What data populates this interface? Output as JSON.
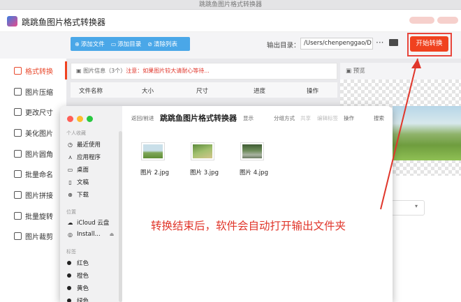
{
  "window": {
    "title": "跳跳鱼图片格式转换器"
  },
  "app": {
    "title": "跳跳鱼图片格式转换器"
  },
  "toolbar": {
    "add_file": "添加文件",
    "add_folder": "添加目录",
    "clear_list": "清除列表",
    "output_label": "输出目录：",
    "output_path": "/Users/chenpenggao/D",
    "more": "···",
    "start": "开始转换"
  },
  "sidebar": {
    "items": [
      {
        "label": "格式转换",
        "active": true
      },
      {
        "label": "图片压缩"
      },
      {
        "label": "更改尺寸"
      },
      {
        "label": "美化图片"
      },
      {
        "label": "图片圆角"
      },
      {
        "label": "批量命名"
      },
      {
        "label": "图片拼接"
      },
      {
        "label": "批量旋转"
      },
      {
        "label": "图片裁剪"
      }
    ]
  },
  "info": {
    "title": "图片信息（3个）",
    "warning": "注意：如果图片较大请耐心等待..."
  },
  "table": {
    "headers": [
      "文件名称",
      "大小",
      "尺寸",
      "进度",
      "操作"
    ]
  },
  "preview": {
    "title": "预览"
  },
  "finder": {
    "nav": "返回/前进",
    "title": "跳跳鱼图片格式转换器",
    "toolbar": [
      "显示",
      "分组方式",
      "共享",
      "编辑标签",
      "操作",
      "搜索"
    ],
    "sections": {
      "favorites": "个人收藏",
      "locations": "位置",
      "tags": "标签"
    },
    "favorites": [
      "最近使用",
      "应用程序",
      "桌面",
      "文稿",
      "下载"
    ],
    "locations": [
      "iCloud 云盘",
      "Install..."
    ],
    "tags": [
      "红色",
      "橙色",
      "黄色",
      "绿色"
    ],
    "files": [
      "图片 2.jpg",
      "图片 3.jpg",
      "图片 4.jpg"
    ]
  },
  "annotation": "转换结束后，软件会自动打开输出文件夹",
  "colors": {
    "accent": "#f0421f",
    "toolbar_blue": "#4aa7e8",
    "annotation_red": "#e0362b"
  }
}
